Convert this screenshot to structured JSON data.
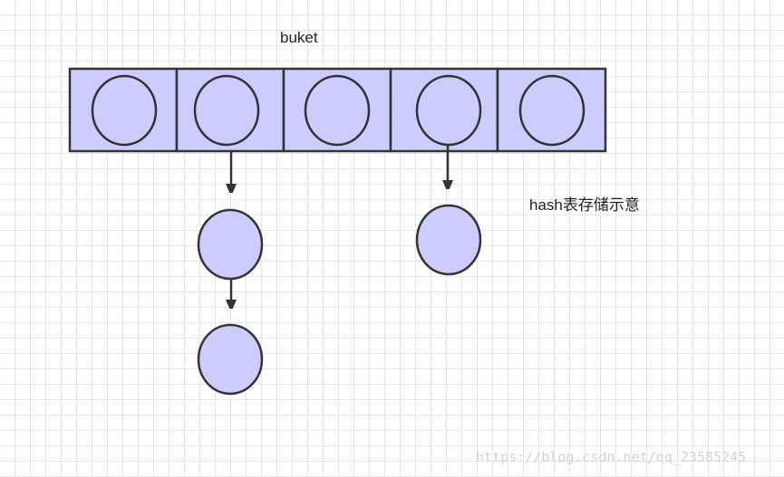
{
  "diagram": {
    "title": "buket",
    "caption": "hash表存储示意",
    "bucket_count": 5,
    "chains": [
      {
        "bucket_index": 1,
        "length": 2
      },
      {
        "bucket_index": 3,
        "length": 1
      }
    ]
  },
  "watermark": "https://blog.csdn.net/qq_23585245",
  "colors": {
    "node_fill": "#ccccff",
    "stroke": "#333333",
    "grid": "#e6e6e6",
    "background": "#ffffff"
  }
}
